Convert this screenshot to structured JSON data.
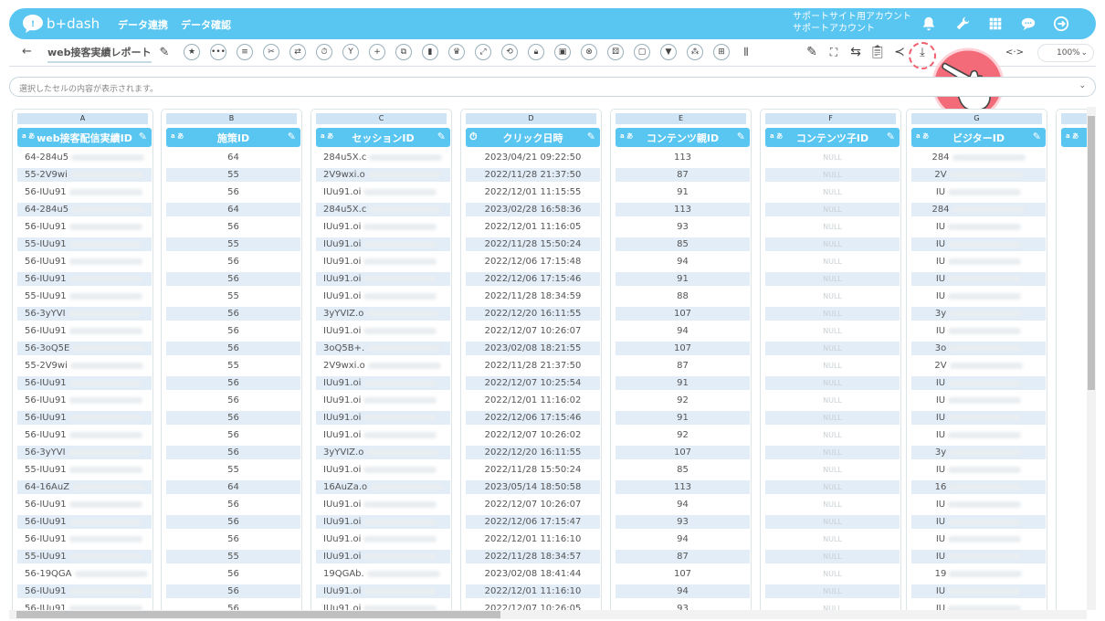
{
  "app": {
    "logo_text": "b+dash"
  },
  "nav": [
    {
      "label": "データ連携"
    },
    {
      "label": "データ確認"
    }
  ],
  "account": {
    "line1": "サポートサイト用アカウント",
    "line2": "サポートアカウント"
  },
  "report": {
    "title": "web接客実績レポート",
    "back": "←"
  },
  "toolbar": {
    "zoom": "100%",
    "code_icon": "<·>"
  },
  "cellbar": {
    "placeholder": "選択したセルの内容が表示されます。"
  },
  "columns": [
    {
      "letter": "A",
      "name": "web接客配信実績ID",
      "type": "text"
    },
    {
      "letter": "B",
      "name": "施策ID",
      "type": "text"
    },
    {
      "letter": "C",
      "name": "セッションID",
      "type": "text"
    },
    {
      "letter": "D",
      "name": "クリック日時",
      "type": "datetime"
    },
    {
      "letter": "E",
      "name": "コンテンツ親ID",
      "type": "text"
    },
    {
      "letter": "F",
      "name": "コンテンツ子ID",
      "type": "text"
    },
    {
      "letter": "G",
      "name": "ビジターID",
      "type": "text"
    }
  ],
  "type_badge": "a あ",
  "null_label": "NULL",
  "rows": [
    {
      "a": "64-284u5",
      "b": "64",
      "c": "284u5X.c",
      "d": "2023/04/21 09:22:50",
      "e": "113",
      "g": "284"
    },
    {
      "a": "55-2V9wi",
      "b": "55",
      "c": "2V9wxi.o",
      "d": "2022/11/28 21:37:50",
      "e": "87",
      "g": "2V"
    },
    {
      "a": "56-IUu91",
      "b": "56",
      "c": "IUu91.oi",
      "d": "2022/12/01 11:15:55",
      "e": "91",
      "g": "IU"
    },
    {
      "a": "64-284u5",
      "b": "64",
      "c": "284u5X.c",
      "d": "2023/02/28 16:58:36",
      "e": "113",
      "g": "284"
    },
    {
      "a": "56-IUu91",
      "b": "56",
      "c": "IUu91.oi",
      "d": "2022/12/01 11:16:05",
      "e": "93",
      "g": "IU"
    },
    {
      "a": "55-IUu91",
      "b": "55",
      "c": "IUu91.oi",
      "d": "2022/11/28 15:50:24",
      "e": "85",
      "g": "IU"
    },
    {
      "a": "56-IUu91",
      "b": "56",
      "c": "IUu91.oi",
      "d": "2022/12/06 17:15:48",
      "e": "94",
      "g": "IU"
    },
    {
      "a": "56-IUu91",
      "b": "56",
      "c": "IUu91.oi",
      "d": "2022/12/06 17:15:46",
      "e": "91",
      "g": "IU"
    },
    {
      "a": "55-IUu91",
      "b": "55",
      "c": "IUu91.oi",
      "d": "2022/11/28 18:34:59",
      "e": "88",
      "g": "IU"
    },
    {
      "a": "56-3yYVI",
      "b": "56",
      "c": "3yYVIZ.o",
      "d": "2022/12/20 16:11:55",
      "e": "107",
      "g": "3y"
    },
    {
      "a": "56-IUu91",
      "b": "56",
      "c": "IUu91.oi",
      "d": "2022/12/07 10:26:07",
      "e": "94",
      "g": "IU"
    },
    {
      "a": "56-3oQ5E",
      "b": "56",
      "c": "3oQ5B+.",
      "d": "2023/02/08 18:21:55",
      "e": "107",
      "g": "3o"
    },
    {
      "a": "55-2V9wi",
      "b": "55",
      "c": "2V9wxi.o",
      "d": "2022/11/28 21:37:50",
      "e": "87",
      "g": "2V"
    },
    {
      "a": "56-IUu91",
      "b": "56",
      "c": "IUu91.oi",
      "d": "2022/12/07 10:25:54",
      "e": "91",
      "g": "IU"
    },
    {
      "a": "56-IUu91",
      "b": "56",
      "c": "IUu91.oi",
      "d": "2022/12/01 11:16:02",
      "e": "92",
      "g": "IU"
    },
    {
      "a": "56-IUu91",
      "b": "56",
      "c": "IUu91.oi",
      "d": "2022/12/06 17:15:46",
      "e": "91",
      "g": "IU"
    },
    {
      "a": "56-IUu91",
      "b": "56",
      "c": "IUu91.oi",
      "d": "2022/12/07 10:26:02",
      "e": "92",
      "g": "IU"
    },
    {
      "a": "56-3yYVI",
      "b": "56",
      "c": "3yYVIZ.o",
      "d": "2022/12/20 16:11:55",
      "e": "107",
      "g": "3y"
    },
    {
      "a": "55-IUu91",
      "b": "55",
      "c": "IUu91.oi",
      "d": "2022/11/28 15:50:24",
      "e": "85",
      "g": "IU"
    },
    {
      "a": "64-16AuZ",
      "b": "64",
      "c": "16AuZa.o",
      "d": "2023/05/14 18:50:58",
      "e": "113",
      "g": "16"
    },
    {
      "a": "56-IUu91",
      "b": "56",
      "c": "IUu91.oi",
      "d": "2022/12/07 10:26:07",
      "e": "94",
      "g": "IU"
    },
    {
      "a": "56-IUu91",
      "b": "56",
      "c": "IUu91.oi",
      "d": "2022/12/06 17:15:47",
      "e": "93",
      "g": "IU"
    },
    {
      "a": "56-IUu91",
      "b": "56",
      "c": "IUu91.oi",
      "d": "2022/12/01 11:16:10",
      "e": "94",
      "g": "IU"
    },
    {
      "a": "55-IUu91",
      "b": "55",
      "c": "IUu91.oi",
      "d": "2022/11/28 18:34:57",
      "e": "87",
      "g": "IU"
    },
    {
      "a": "56-19QGA",
      "b": "56",
      "c": "19QGAb.",
      "d": "2023/02/08 18:41:44",
      "e": "107",
      "g": "19"
    },
    {
      "a": "56-IUu91",
      "b": "56",
      "c": "IUu91.oi",
      "d": "2022/12/01 11:16:10",
      "e": "94",
      "g": "IU"
    },
    {
      "a": "56-IUu91",
      "b": "56",
      "c": "IUu91.oi",
      "d": "2022/12/07 10:26:05",
      "e": "93",
      "g": "IU"
    }
  ],
  "colors": {
    "accent": "#59c5f1",
    "row_alt": "#e2edf8",
    "highlight": "#f0606e"
  }
}
